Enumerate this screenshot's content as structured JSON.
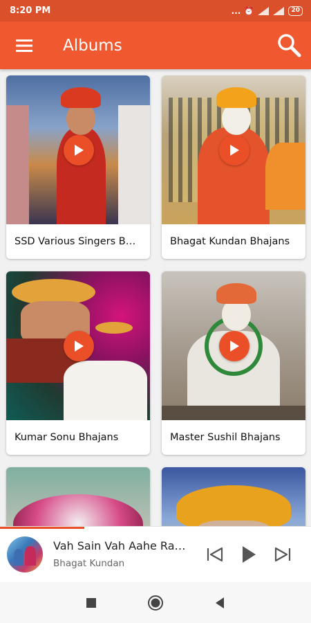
{
  "status_bar": {
    "time": "8:20 PM",
    "indicators": "... ⏰",
    "battery": "20"
  },
  "app_bar": {
    "title": "Albums",
    "menu_icon": "hamburger-menu-icon",
    "search_icon": "search-icon"
  },
  "albums": [
    {
      "name": "SSD Various Singers Bhajans"
    },
    {
      "name": "Bhagat Kundan Bhajans"
    },
    {
      "name": "Kumar Sonu Bhajans"
    },
    {
      "name": "Master Sushil Bhajans"
    },
    {
      "name": ""
    },
    {
      "name": ""
    }
  ],
  "player": {
    "title": "Vah Sain Vah Aahe Rahm",
    "artist": "Bhagat Kundan",
    "progress": 0.27
  },
  "colors": {
    "accent": "#f0582f",
    "status": "#d9502b",
    "play": "#ea4f27"
  }
}
